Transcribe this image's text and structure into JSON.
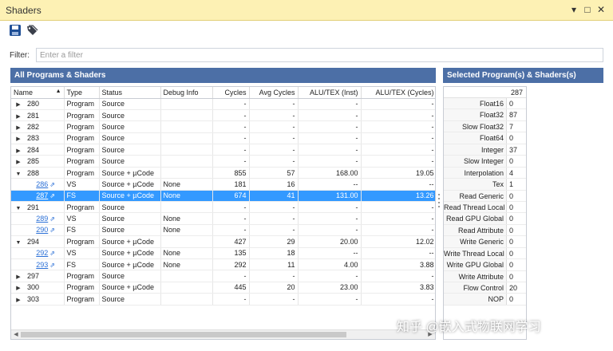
{
  "window": {
    "title": "Shaders"
  },
  "titlebar_controls": [
    "▾",
    "□",
    "✕"
  ],
  "toolbar": {
    "icons": [
      "save-icon",
      "tags-icon"
    ]
  },
  "filter": {
    "label": "Filter:",
    "placeholder": "Enter a filter",
    "value": ""
  },
  "left_panel": {
    "title": "All Programs & Shaders"
  },
  "right_panel": {
    "title": "Selected Program(s) & Shaders(s)",
    "selected_id": "287"
  },
  "columns": [
    "Name",
    "Type",
    "Status",
    "Debug Info",
    "Cycles",
    "Avg Cycles",
    "ALU/TEX (Inst)",
    "ALU/TEX (Cycles)"
  ],
  "rows": [
    {
      "level": 0,
      "expand": "collapsed",
      "name": "280",
      "type": "Program",
      "status": "Source",
      "debug": "",
      "cycles": "-",
      "avg": "-",
      "alu_inst": "-",
      "alu_cyc": "-"
    },
    {
      "level": 0,
      "expand": "collapsed",
      "name": "281",
      "type": "Program",
      "status": "Source",
      "debug": "",
      "cycles": "-",
      "avg": "-",
      "alu_inst": "-",
      "alu_cyc": "-"
    },
    {
      "level": 0,
      "expand": "collapsed",
      "name": "282",
      "type": "Program",
      "status": "Source",
      "debug": "",
      "cycles": "-",
      "avg": "-",
      "alu_inst": "-",
      "alu_cyc": "-"
    },
    {
      "level": 0,
      "expand": "collapsed",
      "name": "283",
      "type": "Program",
      "status": "Source",
      "debug": "",
      "cycles": "-",
      "avg": "-",
      "alu_inst": "-",
      "alu_cyc": "-"
    },
    {
      "level": 0,
      "expand": "collapsed",
      "name": "284",
      "type": "Program",
      "status": "Source",
      "debug": "",
      "cycles": "-",
      "avg": "-",
      "alu_inst": "-",
      "alu_cyc": "-"
    },
    {
      "level": 0,
      "expand": "collapsed",
      "name": "285",
      "type": "Program",
      "status": "Source",
      "debug": "",
      "cycles": "-",
      "avg": "-",
      "alu_inst": "-",
      "alu_cyc": "-"
    },
    {
      "level": 0,
      "expand": "expanded",
      "name": "288",
      "type": "Program",
      "status": "Source + µCode",
      "debug": "",
      "cycles": "855",
      "avg": "57",
      "alu_inst": "168.00",
      "alu_cyc": "19.05"
    },
    {
      "level": 1,
      "expand": "",
      "name": "286",
      "type": "VS",
      "status": "Source + µCode",
      "debug": "None",
      "cycles": "181",
      "avg": "16",
      "alu_inst": "--",
      "alu_cyc": "--"
    },
    {
      "level": 1,
      "expand": "",
      "name": "287",
      "type": "FS",
      "status": "Source + µCode",
      "debug": "None",
      "cycles": "674",
      "avg": "41",
      "alu_inst": "131.00",
      "alu_cyc": "13.26",
      "selected": true
    },
    {
      "level": 0,
      "expand": "expanded",
      "name": "291",
      "type": "Program",
      "status": "Source",
      "debug": "",
      "cycles": "-",
      "avg": "-",
      "alu_inst": "-",
      "alu_cyc": "-"
    },
    {
      "level": 1,
      "expand": "",
      "name": "289",
      "type": "VS",
      "status": "Source",
      "debug": "None",
      "cycles": "-",
      "avg": "-",
      "alu_inst": "-",
      "alu_cyc": "-"
    },
    {
      "level": 1,
      "expand": "",
      "name": "290",
      "type": "FS",
      "status": "Source",
      "debug": "None",
      "cycles": "-",
      "avg": "-",
      "alu_inst": "-",
      "alu_cyc": "-"
    },
    {
      "level": 0,
      "expand": "expanded",
      "name": "294",
      "type": "Program",
      "status": "Source + µCode",
      "debug": "",
      "cycles": "427",
      "avg": "29",
      "alu_inst": "20.00",
      "alu_cyc": "12.02"
    },
    {
      "level": 1,
      "expand": "",
      "name": "292",
      "type": "VS",
      "status": "Source + µCode",
      "debug": "None",
      "cycles": "135",
      "avg": "18",
      "alu_inst": "--",
      "alu_cyc": "--"
    },
    {
      "level": 1,
      "expand": "",
      "name": "293",
      "type": "FS",
      "status": "Source + µCode",
      "debug": "None",
      "cycles": "292",
      "avg": "11",
      "alu_inst": "4.00",
      "alu_cyc": "3.88"
    },
    {
      "level": 0,
      "expand": "collapsed",
      "name": "297",
      "type": "Program",
      "status": "Source",
      "debug": "",
      "cycles": "-",
      "avg": "-",
      "alu_inst": "-",
      "alu_cyc": "-"
    },
    {
      "level": 0,
      "expand": "collapsed",
      "name": "300",
      "type": "Program",
      "status": "Source + µCode",
      "debug": "",
      "cycles": "445",
      "avg": "20",
      "alu_inst": "23.00",
      "alu_cyc": "3.83"
    },
    {
      "level": 0,
      "expand": "collapsed",
      "name": "303",
      "type": "Program",
      "status": "Source",
      "debug": "",
      "cycles": "-",
      "avg": "-",
      "alu_inst": "-",
      "alu_cyc": "-"
    }
  ],
  "stats": [
    {
      "label": "Float16",
      "value": "0"
    },
    {
      "label": "Float32",
      "value": "87"
    },
    {
      "label": "Slow Float32",
      "value": "7"
    },
    {
      "label": "Float64",
      "value": "0"
    },
    {
      "label": "Integer",
      "value": "37"
    },
    {
      "label": "Slow Integer",
      "value": "0"
    },
    {
      "label": "Interpolation",
      "value": "4"
    },
    {
      "label": "Tex",
      "value": "1"
    },
    {
      "label": "Read Generic",
      "value": "0"
    },
    {
      "label": "Read Thread Local",
      "value": "0"
    },
    {
      "label": "Read GPU Global",
      "value": "0"
    },
    {
      "label": "Read Attribute",
      "value": "0"
    },
    {
      "label": "Write Generic",
      "value": "0"
    },
    {
      "label": "Write Thread Local",
      "value": "0"
    },
    {
      "label": "Write GPU Global",
      "value": "0"
    },
    {
      "label": "Write Attribute",
      "value": "0"
    },
    {
      "label": "Flow Control",
      "value": "20"
    },
    {
      "label": "NOP",
      "value": "0"
    }
  ],
  "watermark": "知乎 @嵌入式物联网学习",
  "colors": {
    "titlebar": "#fdf1b4",
    "header": "#4c6fa6",
    "selection": "#3399ff",
    "link": "#2a6fd6"
  }
}
